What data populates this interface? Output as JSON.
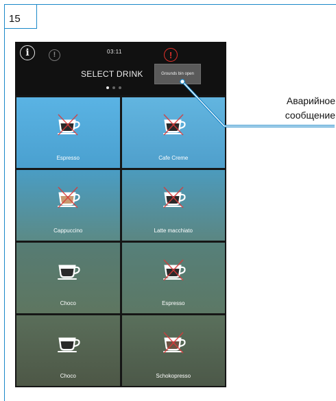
{
  "page": {
    "number": "15"
  },
  "screen": {
    "time": "03:11",
    "title": "SELECT DRINK",
    "alert_message": "Grounds bin open",
    "pages": 3,
    "current_page": 1
  },
  "drinks": [
    {
      "label": "Espresso",
      "icon": "espresso-cup-icon",
      "crossed": true,
      "fill": "#2a2a2a",
      "bg_top": "#5ab3e4",
      "bg_bottom": "#4aa0cf"
    },
    {
      "label": "Cafe Creme",
      "icon": "cafe-creme-cup-icon",
      "crossed": true,
      "fill": "#2a2a2a",
      "bg_top": "#62b5e0",
      "bg_bottom": "#4f9fcb"
    },
    {
      "label": "Cappuccino",
      "icon": "cappuccino-cup-icon",
      "crossed": true,
      "fill": "#c99a70",
      "bg_top": "#4a9dc4",
      "bg_bottom": "#5b8a86"
    },
    {
      "label": "Latte macchiato",
      "icon": "latte-macchiato-glass-icon",
      "crossed": true,
      "fill": "#2a2a2a",
      "bg_top": "#4c9bbd",
      "bg_bottom": "#5b8682"
    },
    {
      "label": "Choco",
      "icon": "choco-cup-icon",
      "crossed": false,
      "fill": "#2a2a2a",
      "bg_top": "#567c74",
      "bg_bottom": "#5e7660"
    },
    {
      "label": "Espresso",
      "icon": "espresso-cup-icon",
      "crossed": true,
      "fill": "#2a2a2a",
      "bg_top": "#56807a",
      "bg_bottom": "#5c7865"
    },
    {
      "label": "Choco",
      "icon": "choco-cup-icon",
      "crossed": false,
      "fill": "#2a2a2a",
      "bg_top": "#5a6e5a",
      "bg_bottom": "#4d5746"
    },
    {
      "label": "Schokopresso",
      "icon": "schokopresso-glass-icon",
      "crossed": true,
      "fill": "#6b5443",
      "bg_top": "#5a705c",
      "bg_bottom": "#4c5848"
    }
  ],
  "callout": {
    "line1": "Аварийное",
    "line2": "сообщение"
  },
  "colors": {
    "frame": "#1a88c9",
    "alert_red": "#e0302a",
    "cross_red": "#d93a3a"
  }
}
